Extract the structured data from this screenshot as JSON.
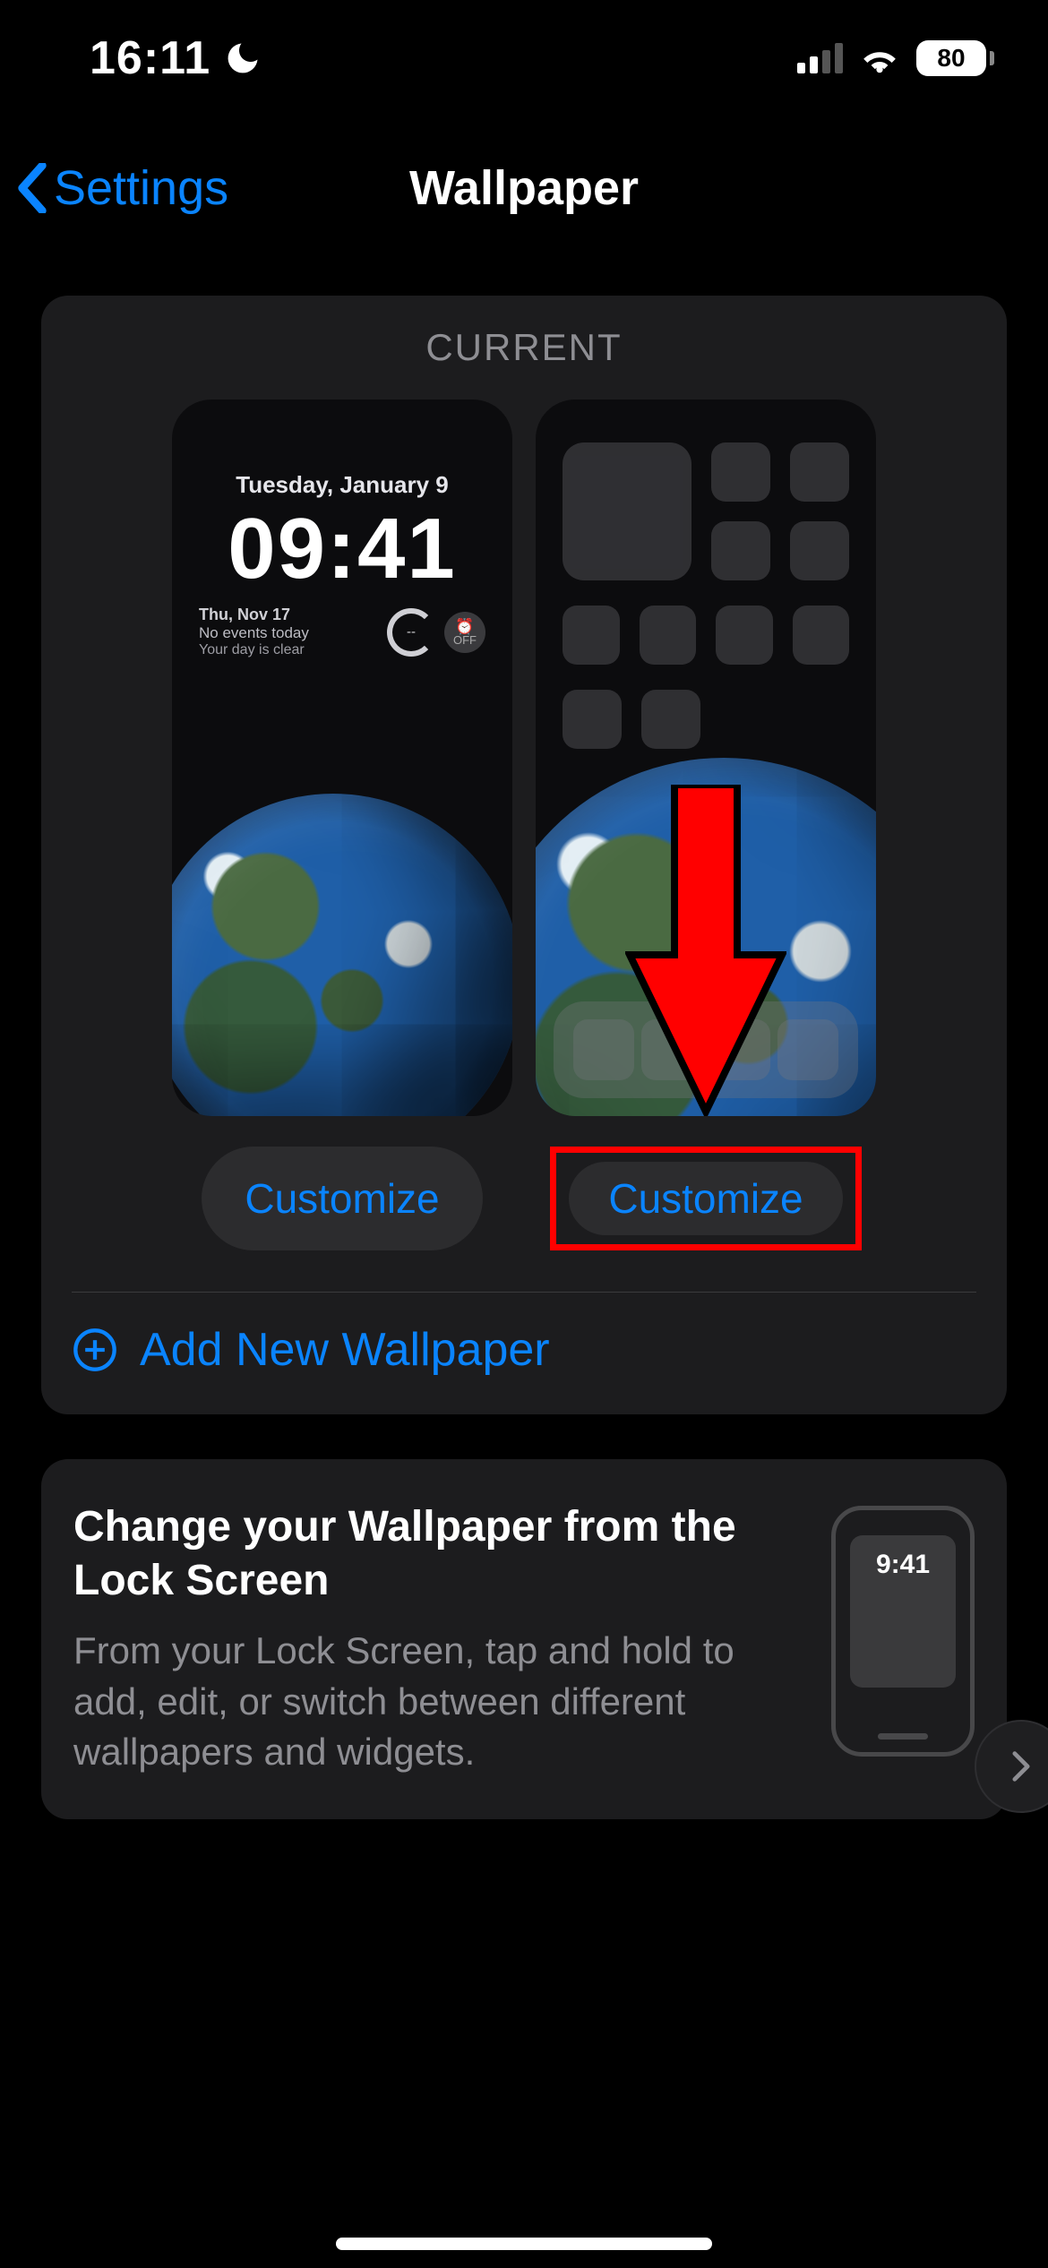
{
  "status": {
    "time": "16:11",
    "battery_pct": "80"
  },
  "nav": {
    "back_label": "Settings",
    "title": "Wallpaper"
  },
  "current": {
    "header": "CURRENT",
    "lock": {
      "date": "Tuesday, January 9",
      "time": "09:41",
      "line1": "Thu, Nov 17",
      "line2": "No events today",
      "line3": "Your day is clear",
      "alarm_badge_top": "⏰",
      "alarm_badge_bottom": "OFF"
    },
    "customize_lock_label": "Customize",
    "customize_home_label": "Customize",
    "add_new_label": "Add New Wallpaper"
  },
  "tip": {
    "title": "Change your Wallpaper from the Lock Screen",
    "body": "From your Lock Screen, tap and hold to add, edit, or switch between different wallpapers and widgets.",
    "phone_time": "9:41"
  }
}
